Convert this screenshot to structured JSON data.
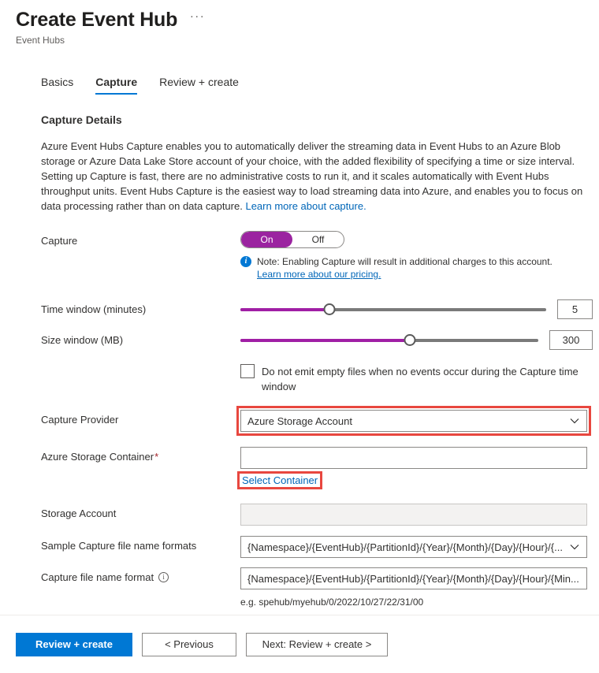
{
  "header": {
    "title": "Create Event Hub",
    "subtitle": "Event Hubs",
    "more_label": "···"
  },
  "tabs": [
    {
      "label": "Basics",
      "active": false
    },
    {
      "label": "Capture",
      "active": true
    },
    {
      "label": "Review + create",
      "active": false
    }
  ],
  "section": {
    "title": "Capture Details",
    "description": "Azure Event Hubs Capture enables you to automatically deliver the streaming data in Event Hubs to an Azure Blob storage or Azure Data Lake Store account of your choice, with the added flexibility of specifying a time or size interval. Setting up Capture is fast, there are no administrative costs to run it, and it scales automatically with Event Hubs throughput units. Event Hubs Capture is the easiest way to load streaming data into Azure, and enables you to focus on data processing rather than on data capture.",
    "description_link": "Learn more about capture."
  },
  "capture": {
    "label": "Capture",
    "on_label": "On",
    "off_label": "Off",
    "selected": "On",
    "note_text": "Note: Enabling Capture will result in additional charges to this account.",
    "note_link": "Learn more about our pricing.",
    "info_glyph": "i"
  },
  "time_window": {
    "label": "Time window (minutes)",
    "value": "5",
    "percent": 29
  },
  "size_window": {
    "label": "Size window (MB)",
    "value": "300",
    "percent": 57
  },
  "skip_empty": {
    "label": "Do not emit empty files when no events occur during the Capture time window",
    "checked": false
  },
  "capture_provider": {
    "label": "Capture Provider",
    "value": "Azure Storage Account",
    "highlighted": true
  },
  "storage_container": {
    "label": "Azure Storage Container",
    "required_marker": "*",
    "value": "",
    "select_link": "Select Container",
    "link_highlighted": true
  },
  "storage_account": {
    "label": "Storage Account",
    "value": "",
    "disabled": true
  },
  "sample_format": {
    "label": "Sample Capture file name formats",
    "value": "{Namespace}/{EventHub}/{PartitionId}/{Year}/{Month}/{Day}/{Hour}/{..."
  },
  "capture_format": {
    "label": "Capture file name format",
    "info_glyph": "i",
    "value": "{Namespace}/{EventHub}/{PartitionId}/{Year}/{Month}/{Day}/{Hour}/{Min...",
    "example": "e.g. spehub/myehub/0/2022/10/27/22/31/00"
  },
  "footer": {
    "primary": "Review + create",
    "previous": "< Previous",
    "next": "Next: Review + create >"
  },
  "colors": {
    "accent_blue": "#0078d4",
    "link_blue": "#0066b8",
    "toggle_purple": "#9b24a0",
    "slider_purple": "#a01fa5",
    "highlight_red": "#e8473f",
    "required_red": "#a4262c"
  }
}
